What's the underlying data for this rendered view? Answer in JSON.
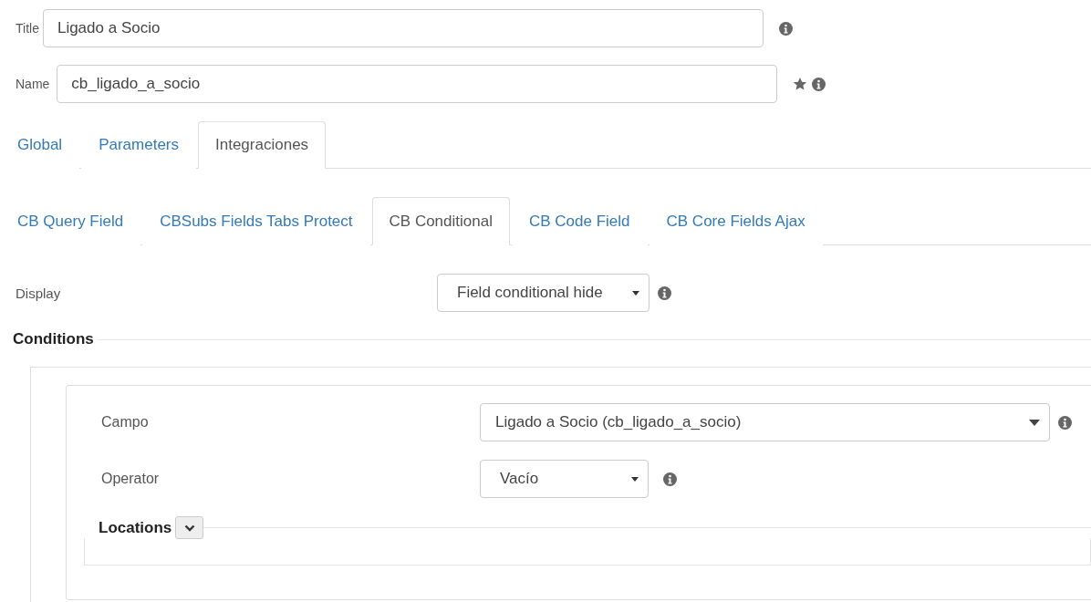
{
  "fields": [
    {
      "label": "Title",
      "value": "Ligado a Socio",
      "required": false
    },
    {
      "label": "Name",
      "value": "cb_ligado_a_socio",
      "required": true
    }
  ],
  "tabs": [
    {
      "label": "Global",
      "selected": false
    },
    {
      "label": "Parameters",
      "selected": false
    },
    {
      "label": "Integraciones",
      "selected": true
    }
  ],
  "subtabs": [
    {
      "label": "CB Query Field",
      "selected": false
    },
    {
      "label": "CBSubs Fields Tabs Protect",
      "selected": false
    },
    {
      "label": "CB Conditional",
      "selected": true
    },
    {
      "label": "CB Code Field",
      "selected": false
    },
    {
      "label": "CB Core Fields Ajax",
      "selected": false
    }
  ],
  "display": {
    "label": "Display",
    "value": "Field conditional hide"
  },
  "conditions": {
    "legend": "Conditions",
    "rows": [
      {
        "label": "Campo",
        "value": "Ligado a Socio (cb_ligado_a_socio)",
        "kind": "wide"
      },
      {
        "label": "Operator",
        "value": "Vacío",
        "kind": "narrow"
      }
    ],
    "locations": {
      "legend": "Locations",
      "expanded": false
    }
  }
}
